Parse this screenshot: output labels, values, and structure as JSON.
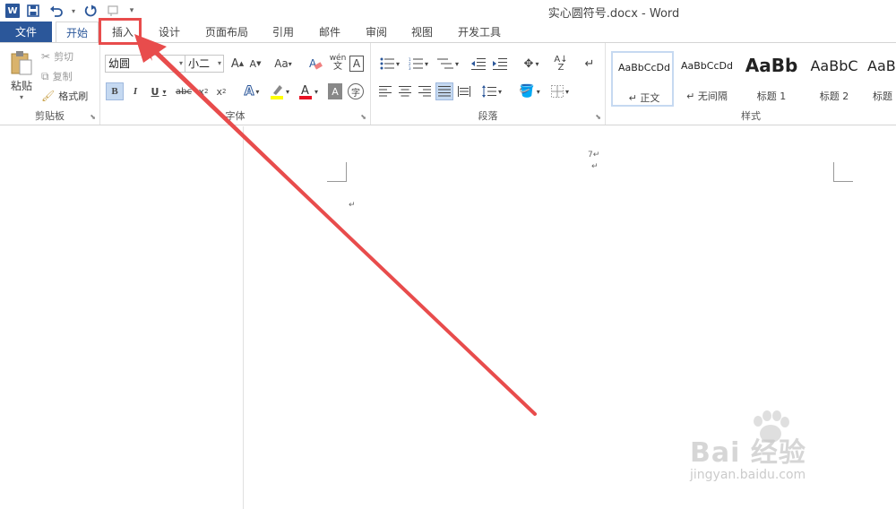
{
  "window": {
    "title": "实心圆符号.docx - Word"
  },
  "qat": {
    "app_icon": "W",
    "save_icon": "save-icon",
    "undo_icon": "undo-icon",
    "redo_icon": "redo-icon",
    "customize_icon": "customize-icon"
  },
  "tabs": [
    {
      "label": "文件"
    },
    {
      "label": "开始"
    },
    {
      "label": "插入"
    },
    {
      "label": "设计"
    },
    {
      "label": "页面布局"
    },
    {
      "label": "引用"
    },
    {
      "label": "邮件"
    },
    {
      "label": "审阅"
    },
    {
      "label": "视图"
    },
    {
      "label": "开发工具"
    }
  ],
  "clipboard": {
    "paste": "粘贴",
    "cut": "剪切",
    "copy": "复制",
    "format_painter": "格式刷",
    "label": "剪贴板"
  },
  "font": {
    "name": "幼圆",
    "size": "小二",
    "label": "字体",
    "change_case": "Aa",
    "phonetic": "wén",
    "phonetic_sub": "文",
    "border_char": "A"
  },
  "paragraph": {
    "label": "段落"
  },
  "styles": {
    "label": "样式",
    "items": [
      {
        "sample": "AaBbCcDd",
        "name": "↵ 正文"
      },
      {
        "sample": "AaBbCcDd",
        "name": "↵ 无间隔"
      },
      {
        "sample": "AaBb",
        "name": "标题 1"
      },
      {
        "sample": "AaBbC",
        "name": "标题 2"
      },
      {
        "sample": "AaB",
        "name": "标题"
      }
    ]
  },
  "document": {
    "mark1": "7↵",
    "mark2": "↵",
    "mark3": "↵"
  },
  "watermark": {
    "brand": "Bai 经验",
    "url": "jingyan.baidu.com"
  },
  "colors": {
    "accent": "#2b579a",
    "annotation": "#e84c4c"
  }
}
